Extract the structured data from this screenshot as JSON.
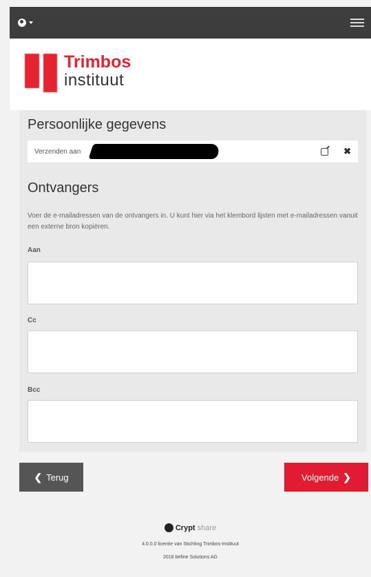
{
  "brand": {
    "line1": "Trimbos",
    "line2": "instituut"
  },
  "personal": {
    "title": "Persoonlijke gegevens",
    "send_to_label": "Verzenden aan"
  },
  "recipients": {
    "title": "Ontvangers",
    "description": "Voer de e-mailadressen van de ontvangers in. U kunt hier via het klembord lijsten met e-mailadressen vanuit een externe bron kopiëren.",
    "to_label": "Aan",
    "cc_label": "Cc",
    "bcc_label": "Bcc",
    "to_value": "",
    "cc_value": "",
    "bcc_value": ""
  },
  "buttons": {
    "back": "Terug",
    "next": "Volgende"
  },
  "footer": {
    "logo_crypt": "Crypt",
    "logo_share": "share",
    "license": "4.0.0.0 licentie van Stichting Trimbos-Instituut",
    "copyright": "2018 befine Solutions AG"
  },
  "colors": {
    "accent": "#e31b32",
    "topbar": "#3d3d3d",
    "back_button": "#555555"
  }
}
